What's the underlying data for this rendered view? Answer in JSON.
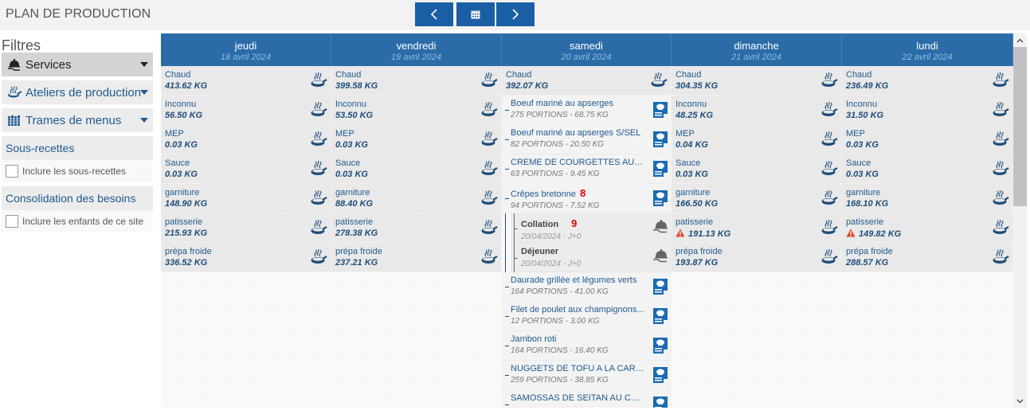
{
  "header": {
    "title": "PLAN DE PRODUCTION",
    "prev_icon": "chevron-left-icon",
    "calendar_icon": "calendar-icon",
    "next_icon": "chevron-right-icon"
  },
  "sidebar": {
    "title": "Filtres",
    "filters": [
      {
        "label": "Services",
        "icon": "service-cloche-icon",
        "active": true
      },
      {
        "label": "Ateliers de production",
        "icon": "cooking-pan-icon",
        "active": false
      },
      {
        "label": "Trames de menus",
        "icon": "menu-frames-icon",
        "active": false
      }
    ],
    "sections": [
      {
        "title": "Sous-recettes",
        "checkbox_label": "Inclure les sous-recettes",
        "checked": false
      },
      {
        "title": "Consolidation des besoins",
        "checkbox_label": "Inclure les enfants de ce site",
        "checked": false
      }
    ]
  },
  "colors": {
    "header_blue": "#2b6ca8",
    "button_blue": "#1a5fa5",
    "text_blue": "#1f5a8e",
    "warning": "#d9472b",
    "annotation_red": "#e00000"
  },
  "days": [
    {
      "name": "jeudi",
      "date": "18 avril 2024",
      "workshops": [
        {
          "label": "Chaud",
          "value": "413.62 KG"
        },
        {
          "label": "Inconnu",
          "value": "56.50 KG"
        },
        {
          "label": "MEP",
          "value": "0.03 KG"
        },
        {
          "label": "Sauce",
          "value": "0.03 KG"
        },
        {
          "label": "garniture",
          "value": "148.90 KG"
        },
        {
          "label": "patisserie",
          "value": "215.93 KG"
        },
        {
          "label": "prépa froide",
          "value": "336.52 KG"
        }
      ]
    },
    {
      "name": "vendredi",
      "date": "19 avril 2024",
      "workshops": [
        {
          "label": "Chaud",
          "value": "399.58 KG"
        },
        {
          "label": "Inconnu",
          "value": "53.50 KG"
        },
        {
          "label": "MEP",
          "value": "0.03 KG"
        },
        {
          "label": "Sauce",
          "value": "0.03 KG"
        },
        {
          "label": "garniture",
          "value": "88.40 KG"
        },
        {
          "label": "patisserie",
          "value": "278.38 KG"
        },
        {
          "label": "prépa froide",
          "value": "237.21 KG"
        }
      ]
    },
    {
      "name": "samedi",
      "date": "20 avril 2024",
      "workshops": [
        {
          "label": "Chaud",
          "value": "392.07 KG"
        }
      ],
      "recipes": [
        {
          "label": "Boeuf mariné au apserges",
          "value": "275 PORTIONS - 68.75 KG"
        },
        {
          "label": "Boeuf mariné au apserges S/SEL",
          "value": "82 PORTIONS - 20.50 KG"
        },
        {
          "label": "CREME DE COURGETTES AU C...",
          "value": "63 PORTIONS - 9.45 KG"
        },
        {
          "label": "Crêpes bretonne",
          "value": "94 PORTIONS - 7.52 KG",
          "annotation": "8",
          "services": [
            {
              "label": "Collation",
              "value": "20/04/2024 - J+0",
              "annotation": "9"
            },
            {
              "label": "Déjeuner",
              "value": "20/04/2024 - J+0"
            }
          ]
        },
        {
          "label": "Daurade grillée et légumes verts",
          "value": "164 PORTIONS - 41.00 KG"
        },
        {
          "label": "Filet de poulet aux champignons...",
          "value": "12 PORTIONS - 3.00 KG"
        },
        {
          "label": "Jambon roti",
          "value": "164 PORTIONS - 16.40 KG"
        },
        {
          "label": "NUGGETS DE TOFU A LA CARO...",
          "value": "259 PORTIONS - 38.85 KG"
        },
        {
          "label": "SAMOSSAS DE SEITAN AU CUR...",
          "value": ""
        }
      ]
    },
    {
      "name": "dimanche",
      "date": "21 avril 2024",
      "workshops": [
        {
          "label": "Chaud",
          "value": "304.35 KG"
        },
        {
          "label": "Inconnu",
          "value": "48.25 KG"
        },
        {
          "label": "MEP",
          "value": "0.04 KG"
        },
        {
          "label": "Sauce",
          "value": "0.03 KG"
        },
        {
          "label": "garniture",
          "value": "166.50 KG"
        },
        {
          "label": "patisserie",
          "value": "191.13 KG",
          "warning": true
        },
        {
          "label": "prépa froide",
          "value": "193.87 KG"
        }
      ]
    },
    {
      "name": "lundi",
      "date": "22 avril 2024",
      "workshops": [
        {
          "label": "Chaud",
          "value": "236.49 KG"
        },
        {
          "label": "Inconnu",
          "value": "31.50 KG"
        },
        {
          "label": "MEP",
          "value": "0.03 KG"
        },
        {
          "label": "Sauce",
          "value": "0.03 KG"
        },
        {
          "label": "garniture",
          "value": "168.10 KG"
        },
        {
          "label": "patisserie",
          "value": "149.82 KG",
          "warning": true
        },
        {
          "label": "prépa froide",
          "value": "288.57 KG"
        }
      ]
    }
  ]
}
